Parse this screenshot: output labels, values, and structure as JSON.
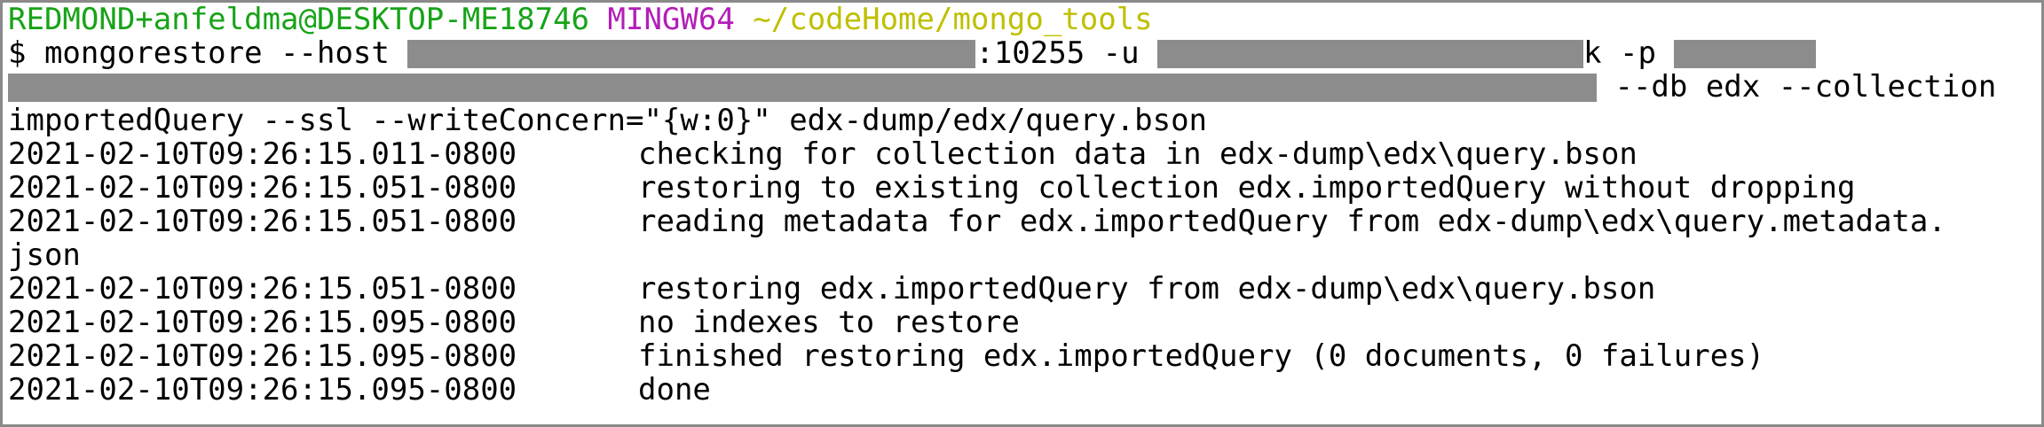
{
  "prompt": {
    "user_host": "REDMOND+anfeldma@DESKTOP-ME18746",
    "system": "MINGW64",
    "path": "~/codeHome/mongo_tools"
  },
  "command": {
    "prefix": "$ mongorestore --host ",
    "port_user": ":10255 -u ",
    "user_tail": "k -p ",
    "db_collection": " --db edx --collection",
    "continuation": "importedQuery --ssl --writeConcern=\"{w:0}\" edx-dump/edx/query.bson"
  },
  "log": [
    {
      "timestamp": "2021-02-10T09:26:15.011-0800",
      "message": "checking for collection data in edx-dump\\edx\\query.bson"
    },
    {
      "timestamp": "2021-02-10T09:26:15.051-0800",
      "message": "restoring to existing collection edx.importedQuery without dropping"
    },
    {
      "timestamp": "2021-02-10T09:26:15.051-0800",
      "message": "reading metadata for edx.importedQuery from edx-dump\\edx\\query.metadata."
    },
    {
      "timestamp": "",
      "message": "json"
    },
    {
      "timestamp": "2021-02-10T09:26:15.051-0800",
      "message": "restoring edx.importedQuery from edx-dump\\edx\\query.bson"
    },
    {
      "timestamp": "2021-02-10T09:26:15.095-0800",
      "message": "no indexes to restore"
    },
    {
      "timestamp": "2021-02-10T09:26:15.095-0800",
      "message": "finished restoring edx.importedQuery (0 documents, 0 failures)"
    },
    {
      "timestamp": "2021-02-10T09:26:15.095-0800",
      "message": "done"
    }
  ],
  "colors": {
    "user_host": "#17a317",
    "system": "#b21eb8",
    "path": "#bfbf00",
    "redaction": "#8c8c8c",
    "text": "#000000",
    "background": "#ffffff"
  }
}
